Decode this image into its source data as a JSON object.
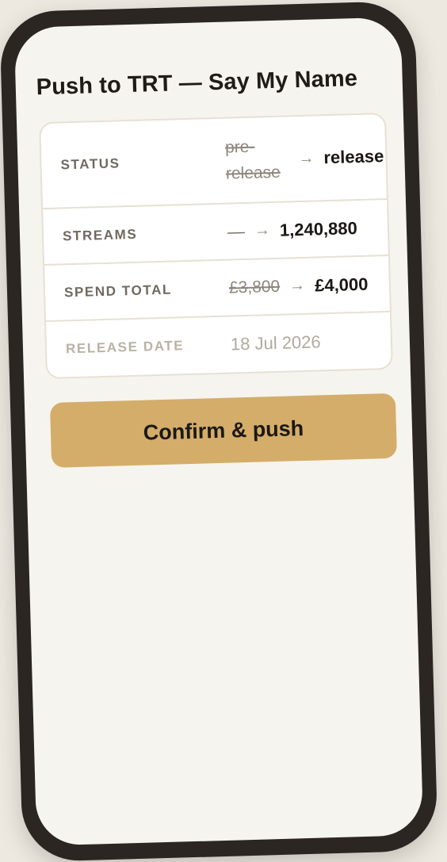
{
  "screen": {
    "title": "Push to TRT — Say My Name"
  },
  "changes": {
    "status": {
      "label": "STATUS",
      "old": "pre-release",
      "arrow": "→",
      "new": "release"
    },
    "streams": {
      "label": "STREAMS",
      "old": "—",
      "arrow": "→",
      "new": "1,240,880"
    },
    "spend_total": {
      "label": "SPEND TOTAL",
      "old": "£3,800",
      "arrow": "→",
      "new": "£4,000"
    },
    "release_date": {
      "label": "RELEASE DATE",
      "value": "18 Jul 2026"
    }
  },
  "actions": {
    "confirm_label": "Confirm & push"
  },
  "colors": {
    "accent": "#d4ad6a",
    "background": "#f6f4ee",
    "frame": "#2b2622"
  }
}
